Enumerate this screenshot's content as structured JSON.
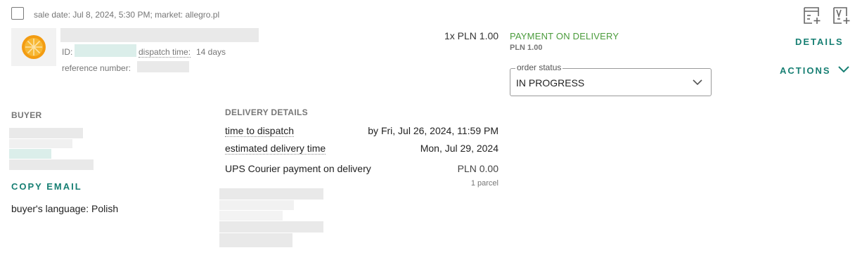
{
  "order": {
    "sale_meta": "sale date:  Jul 8, 2024, 5:30 PM; market: allegro.pl",
    "id_label": "ID:",
    "dispatch_label": "dispatch time:",
    "dispatch_value": "14 days",
    "reference_label": "reference number:",
    "quantity_price": "1x PLN 1.00"
  },
  "payment": {
    "method": "PAYMENT ON DELIVERY",
    "amount": "PLN 1.00"
  },
  "status": {
    "legend": "order status",
    "value": "IN PROGRESS"
  },
  "actions": {
    "details": "DETAILS",
    "actions": "ACTIONS"
  },
  "buyer": {
    "heading": "BUYER",
    "copy_email": "COPY EMAIL",
    "language": "buyer's language: Polish"
  },
  "delivery": {
    "heading": "DELIVERY DETAILS",
    "rows": [
      {
        "label": "time to dispatch",
        "value": "by Fri, Jul 26, 2024, 11:59 PM"
      },
      {
        "label": "estimated delivery time",
        "value": "Mon, Jul 29, 2024"
      },
      {
        "label": "UPS Courier payment on delivery",
        "value": "PLN 0.00"
      }
    ],
    "parcel_count": "1 parcel"
  },
  "icons": {
    "invoice_add": "invoice-add-icon",
    "voucher": "voucher-icon",
    "chevron": "chevron-down-icon",
    "product": "orange-slice-icon"
  },
  "colors": {
    "accent_teal": "#177f73",
    "payment_green": "#4a9b3b"
  }
}
